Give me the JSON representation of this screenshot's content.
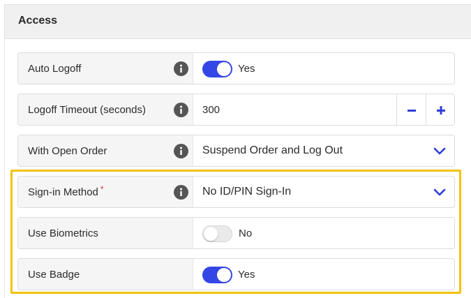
{
  "panel": {
    "title": "Access"
  },
  "rows": {
    "auto_logoff": {
      "label": "Auto Logoff",
      "toggle_on": true,
      "value": "Yes"
    },
    "logoff_timeout": {
      "label": "Logoff Timeout (seconds)",
      "value": "300"
    },
    "with_open_order": {
      "label": "With Open Order",
      "value": "Suspend Order and Log Out"
    },
    "sign_in_method": {
      "label": "Sign-in Method",
      "required_mark": "*",
      "value": "No ID/PIN Sign-In"
    },
    "use_biometrics": {
      "label": "Use Biometrics",
      "toggle_on": false,
      "value": "No"
    },
    "use_badge": {
      "label": "Use Badge",
      "toggle_on": true,
      "value": "Yes"
    }
  },
  "colors": {
    "accent": "#3447e6",
    "highlight": "#f3c20f",
    "required": "#d43a3a",
    "label_bg": "#f5f5f5",
    "header_bg": "#f0f0f0"
  },
  "icons": [
    "info-icon",
    "chevron-down-icon",
    "minus-icon",
    "plus-icon"
  ]
}
